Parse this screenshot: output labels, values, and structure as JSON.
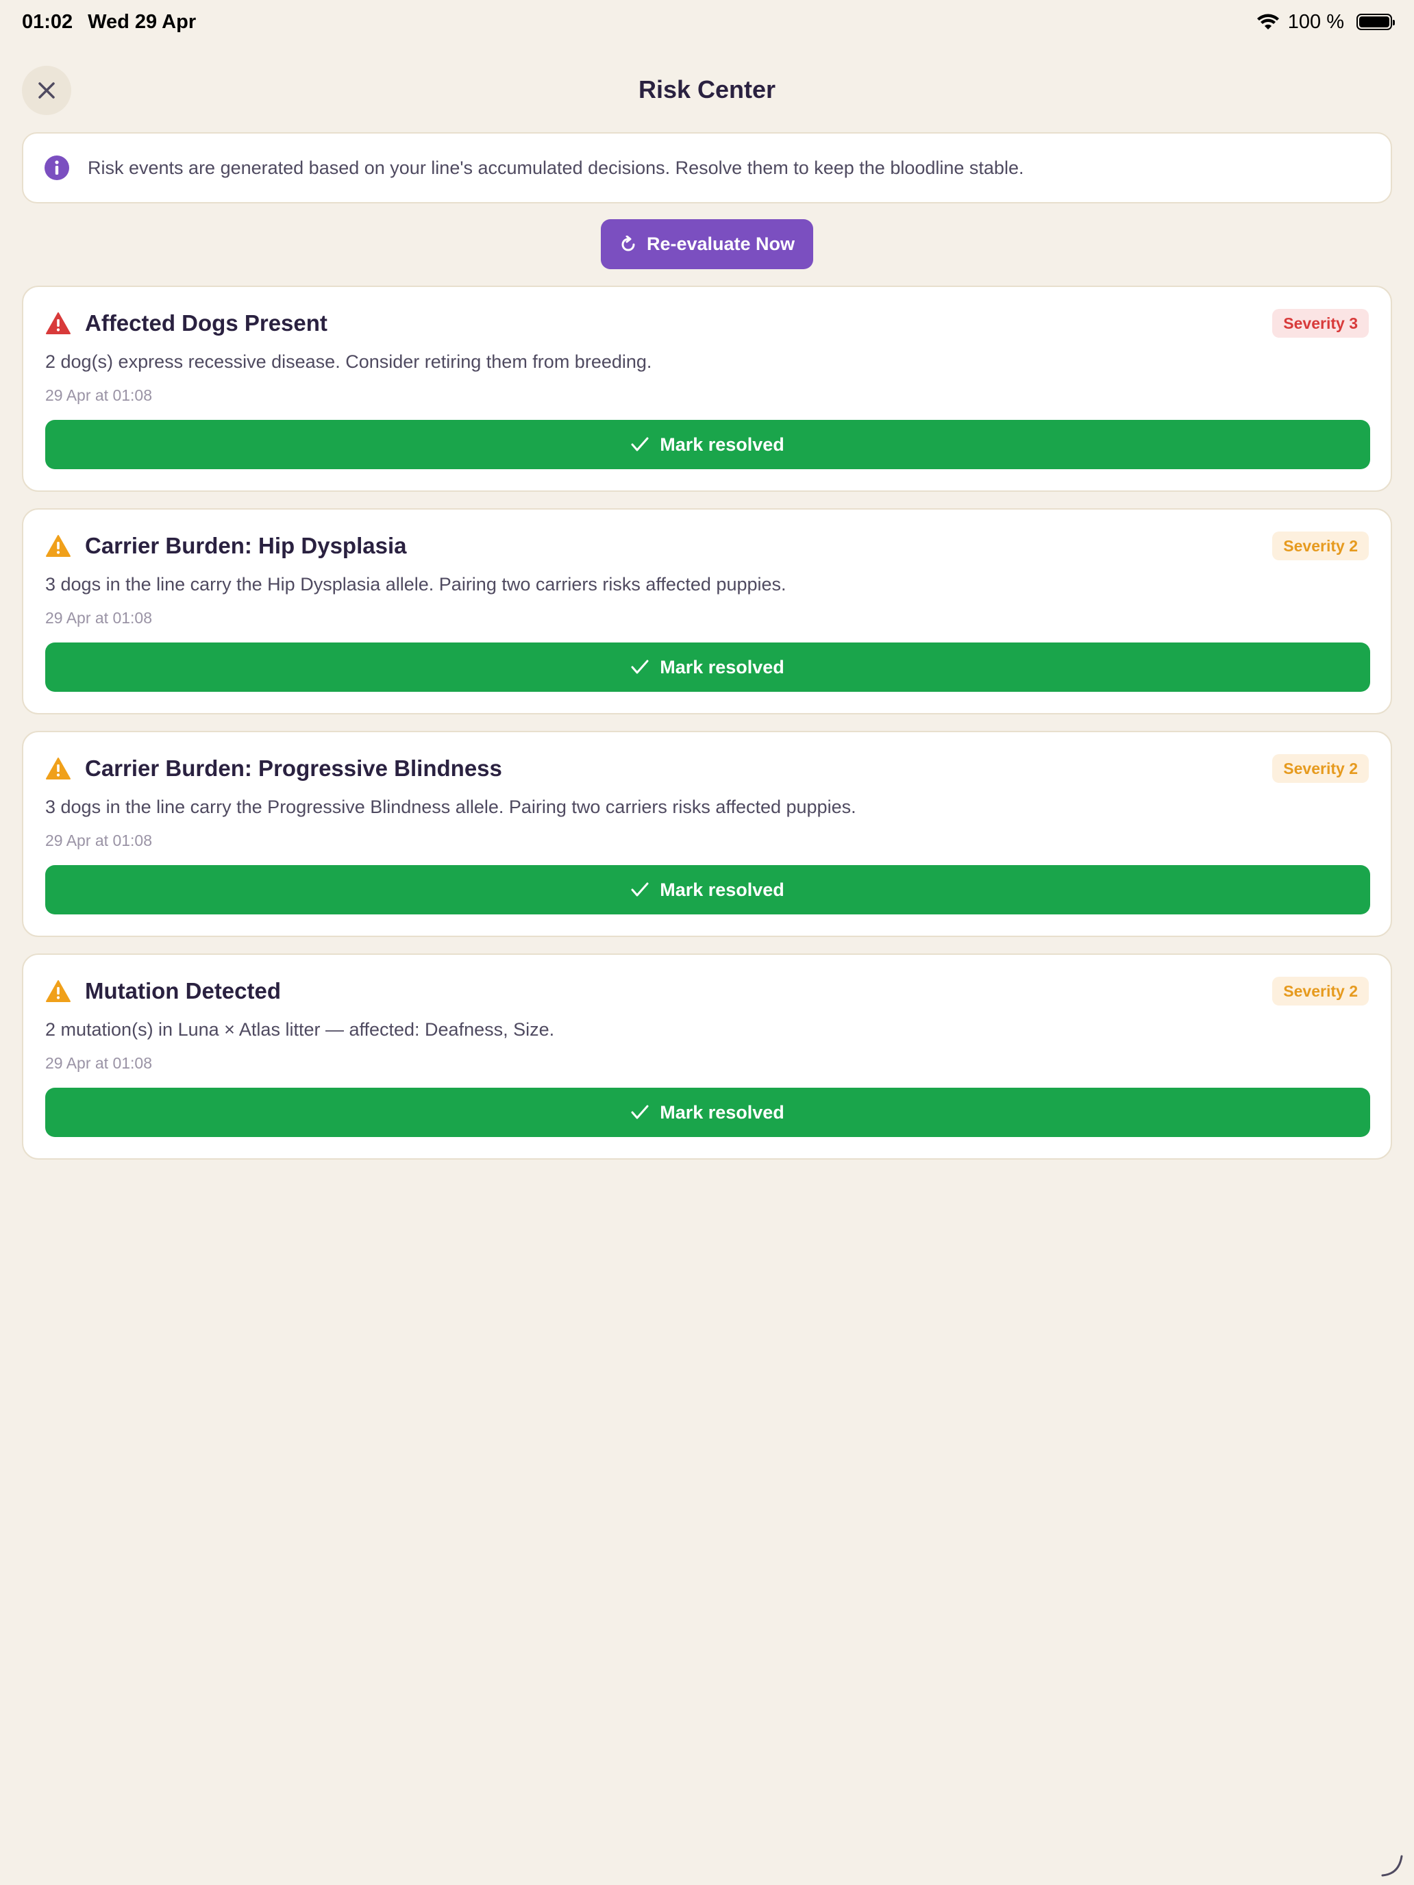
{
  "status_bar": {
    "time": "01:02",
    "date": "Wed 29 Apr",
    "battery": "100 %"
  },
  "header": {
    "title": "Risk Center"
  },
  "info": {
    "text": "Risk events are generated based on your line's accumulated decisions. Resolve them to keep the bloodline stable."
  },
  "reevaluate_label": "Re-evaluate Now",
  "colors": {
    "accent": "#7b4fc0",
    "resolve": "#1aa54b",
    "severe": "#d83a3a",
    "warning": "#f0a01a"
  },
  "events": [
    {
      "title": "Affected Dogs Present",
      "severity": "Severity 3",
      "level": 3,
      "description": "2 dog(s) express recessive disease. Consider retiring them from breeding.",
      "time": "29 Apr at 01:08",
      "action": "Mark resolved"
    },
    {
      "title": "Carrier Burden: Hip Dysplasia",
      "severity": "Severity 2",
      "level": 2,
      "description": "3 dogs in the line carry the Hip Dysplasia allele. Pairing two carriers risks affected puppies.",
      "time": "29 Apr at 01:08",
      "action": "Mark resolved"
    },
    {
      "title": "Carrier Burden: Progressive Blindness",
      "severity": "Severity 2",
      "level": 2,
      "description": "3 dogs in the line carry the Progressive Blindness allele. Pairing two carriers risks affected puppies.",
      "time": "29 Apr at 01:08",
      "action": "Mark resolved"
    },
    {
      "title": "Mutation Detected",
      "severity": "Severity 2",
      "level": 2,
      "description": "2 mutation(s) in Luna × Atlas litter — affected: Deafness, Size.",
      "time": "29 Apr at 01:08",
      "action": "Mark resolved"
    }
  ]
}
